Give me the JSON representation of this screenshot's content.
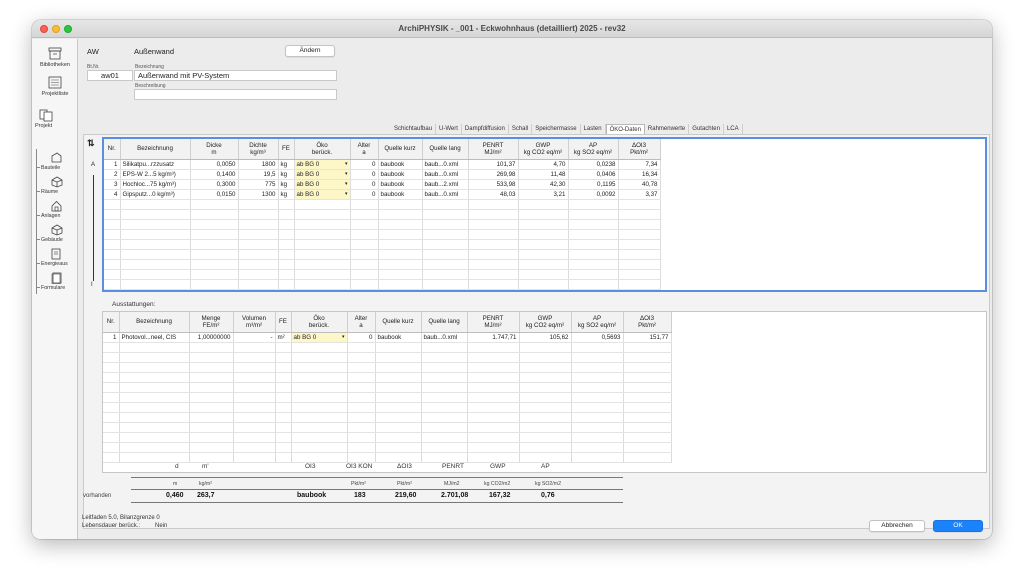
{
  "window": {
    "title": "ArchiPHYSIK - _001 - Eckwohnhaus (detailliert) 2025 - rev32"
  },
  "sidebar": {
    "items": [
      {
        "label": "Bibliotheken"
      },
      {
        "label": "Projektliste"
      },
      {
        "label": "Projekt"
      }
    ],
    "subitems": [
      {
        "label": "Bauteile"
      },
      {
        "label": "Räume"
      },
      {
        "label": "Anlagen"
      },
      {
        "label": "Gebäude"
      },
      {
        "label": "Energieaus"
      },
      {
        "label": "Formulare"
      }
    ]
  },
  "header": {
    "type_code": "AW",
    "type_name": "Außenwand",
    "change_button": "Ändern",
    "bt_nr_label": "Bt.Nr.",
    "bt_nr": "aw01",
    "bezeichnung_label": "Bezeichnung",
    "bezeichnung": "Außenwand mit PV-System",
    "beschreibung_label": "Beschreibung",
    "beschreibung": ""
  },
  "tabs": [
    {
      "label": "Schichtaufbau",
      "active": false
    },
    {
      "label": "U-Wert",
      "active": false
    },
    {
      "label": "Dampfdiffusion",
      "active": false
    },
    {
      "label": "Schall",
      "active": false
    },
    {
      "label": "Speichermasse",
      "active": false
    },
    {
      "label": "Lasten",
      "active": false
    },
    {
      "label": "ÖKO-Daten",
      "active": true
    },
    {
      "label": "Rahmenwerte",
      "active": false
    },
    {
      "label": "Gutachten",
      "active": false
    },
    {
      "label": "LCA",
      "active": false
    }
  ],
  "layers": {
    "side_a": "A",
    "side_i": "I",
    "columns": [
      {
        "l1": "Nr.",
        "l2": ""
      },
      {
        "l1": "Bezeichnung",
        "l2": ""
      },
      {
        "l1": "Dicke",
        "l2": "m"
      },
      {
        "l1": "Dichte",
        "l2": "kg/m³"
      },
      {
        "l1": "FE",
        "l2": ""
      },
      {
        "l1": "Öko",
        "l2": "berück."
      },
      {
        "l1": "Alter",
        "l2": "a"
      },
      {
        "l1": "Quelle kurz",
        "l2": ""
      },
      {
        "l1": "Quelle lang",
        "l2": ""
      },
      {
        "l1": "PENRT",
        "l2": "MJ/m²"
      },
      {
        "l1": "GWP",
        "l2": "kg CO2 eq/m²"
      },
      {
        "l1": "AP",
        "l2": "kg SO2 eq/m²"
      },
      {
        "l1": "ΔOI3",
        "l2": "Pkt/m²"
      }
    ],
    "rows": [
      {
        "nr": "1",
        "bez": "Silikatpu...rzzusatz",
        "dicke": "0,0050",
        "dichte": "1800",
        "fe": "kg",
        "oeko": "ab BG 0",
        "alter": "0",
        "qk": "baubook",
        "ql": "baub...0.xml",
        "penrt": "101,37",
        "gwp": "4,70",
        "ap": "0,0238",
        "oi3": "7,34"
      },
      {
        "nr": "2",
        "bez": "EPS-W 2...5 kg/m³)",
        "dicke": "0,1400",
        "dichte": "19,5",
        "fe": "kg",
        "oeko": "ab BG 0",
        "alter": "0",
        "qk": "baubook",
        "ql": "baub...0.xml",
        "penrt": "269,98",
        "gwp": "11,48",
        "ap": "0,0406",
        "oi3": "16,34"
      },
      {
        "nr": "3",
        "bez": "Hochloc...75 kg/m³)",
        "dicke": "0,3000",
        "dichte": "775",
        "fe": "kg",
        "oeko": "ab BG 0",
        "alter": "0",
        "qk": "baubook",
        "ql": "baub...2.xml",
        "penrt": "533,98",
        "gwp": "42,30",
        "ap": "0,1195",
        "oi3": "40,78"
      },
      {
        "nr": "4",
        "bez": "Gipsputz...0 kg/m³)",
        "dicke": "0,0150",
        "dichte": "1300",
        "fe": "kg",
        "oeko": "ab BG 0",
        "alter": "0",
        "qk": "baubook",
        "ql": "baub...0.xml",
        "penrt": "48,03",
        "gwp": "3,21",
        "ap": "0,0092",
        "oi3": "3,37"
      }
    ]
  },
  "equipment": {
    "title": "Ausstattungen:",
    "columns": [
      {
        "l1": "Nr.",
        "l2": ""
      },
      {
        "l1": "Bezeichnung",
        "l2": ""
      },
      {
        "l1": "Menge",
        "l2": "FE/m²"
      },
      {
        "l1": "Volumen",
        "l2": "m³/m²"
      },
      {
        "l1": "FE",
        "l2": ""
      },
      {
        "l1": "Öko",
        "l2": "berück."
      },
      {
        "l1": "Alter",
        "l2": "a"
      },
      {
        "l1": "Quelle kurz",
        "l2": ""
      },
      {
        "l1": "Quelle lang",
        "l2": ""
      },
      {
        "l1": "PENRT",
        "l2": "MJ/m²"
      },
      {
        "l1": "GWP",
        "l2": "kg CO2 eq/m²"
      },
      {
        "l1": "AP",
        "l2": "kg SO2 eq/m²"
      },
      {
        "l1": "ΔOI3",
        "l2": "Pkt/m²"
      }
    ],
    "rows": [
      {
        "nr": "1",
        "bez": "Photovol...neel, CIS",
        "menge": "1,00000000",
        "vol": "-",
        "fe": "m²",
        "oeko": "ab BG 0",
        "alter": "0",
        "qk": "baubook",
        "ql": "baub...0.xml",
        "penrt": "1.747,71",
        "gwp": "105,62",
        "ap": "0,5693",
        "oi3": "151,77"
      }
    ]
  },
  "summary": {
    "headers": [
      "d",
      "m'",
      "OI3",
      "OI3 KON",
      "ΔOI3",
      "PENRT",
      "GWP",
      "AP"
    ],
    "units": [
      "m",
      "kg/m²",
      "Pkt/m²",
      "Pkt/m²",
      "MJ/m2",
      "kg CO2/m2",
      "kg SO2/m2"
    ],
    "row_label": "vorhanden",
    "values": {
      "d": "0,460",
      "m": "263,7",
      "oi3": "baubook",
      "oi3kon": "183",
      "doi3": "219,60",
      "penrt": "2.701,08",
      "gwp": "167,32",
      "ap": "0,76"
    }
  },
  "footer": {
    "line1": "Leitfaden 5.0, Bilanzgrenze 0",
    "line2_label": "Lebensdauer berück.:",
    "line2_value": "Nein",
    "cancel": "Abbrechen",
    "ok": "OK"
  }
}
